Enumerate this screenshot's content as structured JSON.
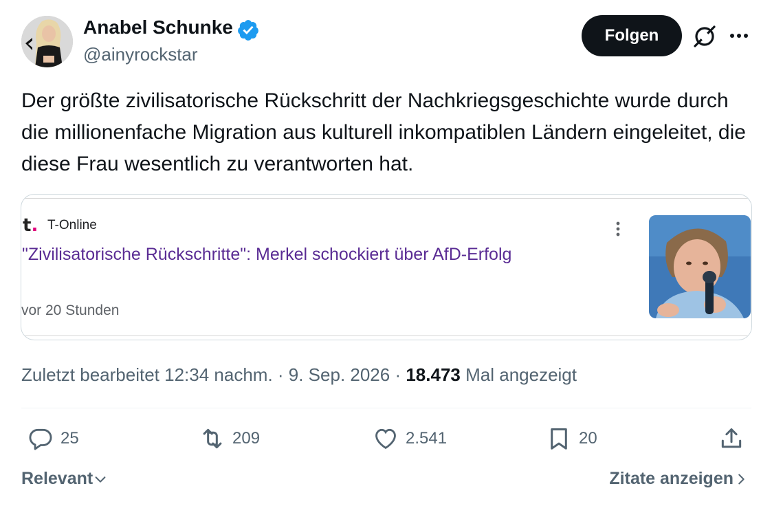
{
  "author": {
    "name": "Anabel Schunke",
    "handle": "@ainyrockstar",
    "verified": true,
    "verified_color": "#1d9bf0"
  },
  "header": {
    "follow_label": "Folgen",
    "grok_icon": "grok-icon",
    "more_icon": "more-icon"
  },
  "tweet": {
    "text": "Der größte zivilisatorische Rückschritt der Nachkriegsgeschichte wurde durch die millionenfache Migration aus kulturell inkompatiblen Ländern eingeleitet, die diese Frau wesentlich zu verantworten hat."
  },
  "card": {
    "source_logo": "t",
    "source_logo_dot": ".",
    "source_name": "T-Online",
    "headline": "\"Zivilisatorische Rückschritte\": Merkel schockiert über AfD-Erfolg",
    "age": "vor 20 Stunden",
    "headline_color": "#5a2c94"
  },
  "meta": {
    "edited_prefix": "Zuletzt bearbeitet 12:34 nachm. · 9. Sep. 2026 · ",
    "views_count": "18.473",
    "views_suffix": "Mal angezeigt"
  },
  "actions": {
    "replies": "25",
    "reposts": "209",
    "likes": "2.541",
    "bookmarks": "20"
  },
  "footer": {
    "sort_label": "Relevant",
    "quotes_label": "Zitate anzeigen"
  }
}
